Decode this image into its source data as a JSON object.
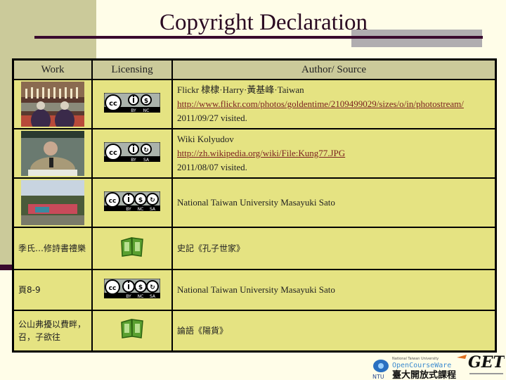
{
  "title": "Copyright Declaration",
  "table": {
    "headers": [
      "Work",
      "Licensing",
      "Author/ Source"
    ],
    "rows": [
      {
        "work_type": "image",
        "work_desc": "photo-ceremony",
        "license": "cc-by-nc",
        "license_labels": [
          "BY",
          "NC"
        ],
        "source_lines": [
          "Flickr  棣棣·Harry·黃基峰·Taiwan",
          "http://www.flickr.com/photos/goldentime/2109499029/sizes/o/in/photostream/",
          "2011/09/27 visited."
        ]
      },
      {
        "work_type": "image",
        "work_desc": "photo-elderly-man",
        "license": "cc-by-sa",
        "license_labels": [
          "BY",
          "SA"
        ],
        "source_lines": [
          "Wiki Kolyudov",
          "http://zh.wikipedia.org/wiki/File:Kung77.JPG",
          "2011/08/07 visited."
        ]
      },
      {
        "work_type": "image",
        "work_desc": "photo-temple",
        "license": "cc-by-nc-sa",
        "license_labels": [
          "BY",
          "NC",
          "SA"
        ],
        "source_lines": [
          "National Taiwan University Masayuki Sato"
        ]
      },
      {
        "work_type": "text",
        "work_text": "季氏…修詩書禮樂",
        "license": "public-domain-book",
        "source_lines": [
          "史記《孔子世家》"
        ]
      },
      {
        "work_type": "text",
        "work_text": "頁8-9",
        "license": "cc-by-nc-sa",
        "license_labels": [
          "BY",
          "NC",
          "SA"
        ],
        "source_lines": [
          "National Taiwan University Masayuki Sato"
        ]
      },
      {
        "work_type": "text",
        "work_text": "公山弗擾以費畔，召，子欲往",
        "license": "public-domain-book",
        "source_lines": [
          "論語《陽貨》"
        ]
      }
    ]
  },
  "footer_logo": {
    "line1": "National Taiwan University",
    "line2": "OpenCourseWare",
    "line3": "臺大開放式課程",
    "badge": "NTU",
    "get_text": "GET"
  },
  "colors": {
    "link": "#7a1f1f",
    "cell_bg": "#e5e382",
    "header_bg": "#cbca9a",
    "accent": "#3a0a2e"
  }
}
